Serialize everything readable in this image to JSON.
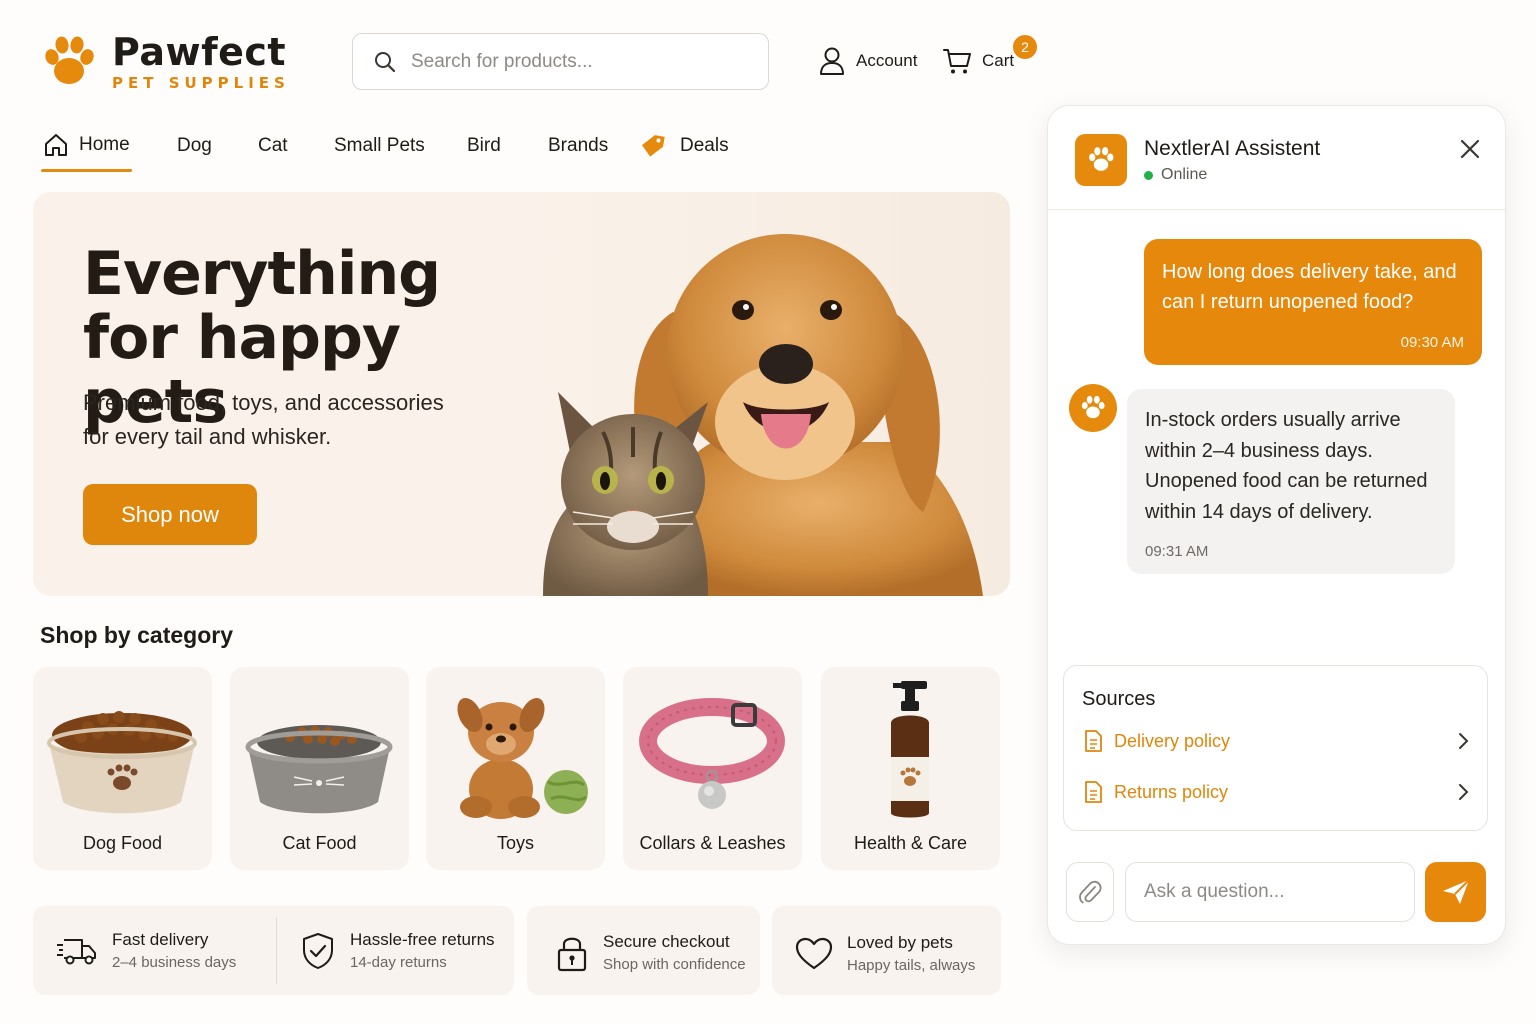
{
  "brand": {
    "name": "Pawfect",
    "tagline": "PET SUPPLIES",
    "accent": "#e58a0d"
  },
  "header": {
    "search_placeholder": "Search for products...",
    "account_label": "Account",
    "cart_label": "Cart",
    "cart_count": "2"
  },
  "nav": {
    "items": [
      {
        "label": "Home",
        "icon": "home-icon",
        "active": true
      },
      {
        "label": "Dog"
      },
      {
        "label": "Cat"
      },
      {
        "label": "Small Pets"
      },
      {
        "label": "Bird"
      },
      {
        "label": "Brands"
      },
      {
        "label": "Deals",
        "icon": "tag-icon"
      }
    ]
  },
  "hero": {
    "title": "Everything for happy pets",
    "subtitle": "Premium food, toys, and accessories for every tail and whisker.",
    "cta": "Shop now"
  },
  "categories": {
    "title": "Shop by category",
    "items": [
      {
        "label": "Dog Food",
        "icon": "dog-food-bowl-image"
      },
      {
        "label": "Cat Food",
        "icon": "cat-food-bowl-image"
      },
      {
        "label": "Toys",
        "icon": "teddy-toy-image"
      },
      {
        "label": "Collars & Leashes",
        "icon": "collar-image"
      },
      {
        "label": "Health & Care",
        "icon": "pump-bottle-image"
      }
    ]
  },
  "features": [
    {
      "title": "Fast delivery",
      "subtitle": "2–4 business days",
      "icon": "truck-icon"
    },
    {
      "title": "Hassle-free returns",
      "subtitle": "14-day returns",
      "icon": "shield-check-icon"
    },
    {
      "title": "Secure checkout",
      "subtitle": "Shop with confidence",
      "icon": "lock-icon"
    },
    {
      "title": "Loved by pets",
      "subtitle": "Happy tails, always",
      "icon": "heart-icon"
    }
  ],
  "chat": {
    "title": "NextlerAI Assistent",
    "status": "Online",
    "user_message": {
      "text": "How long does delivery take, and can I return unopened food?",
      "time": "09:30 AM"
    },
    "bot_message": {
      "text": "In-stock orders usually arrive within 2–4 business days. Unopened food can be returned within 14 days of delivery.",
      "time": "09:31 AM"
    },
    "sources": {
      "title": "Sources",
      "items": [
        {
          "label": "Delivery policy"
        },
        {
          "label": "Returns policy"
        }
      ]
    },
    "input_placeholder": "Ask a question..."
  }
}
